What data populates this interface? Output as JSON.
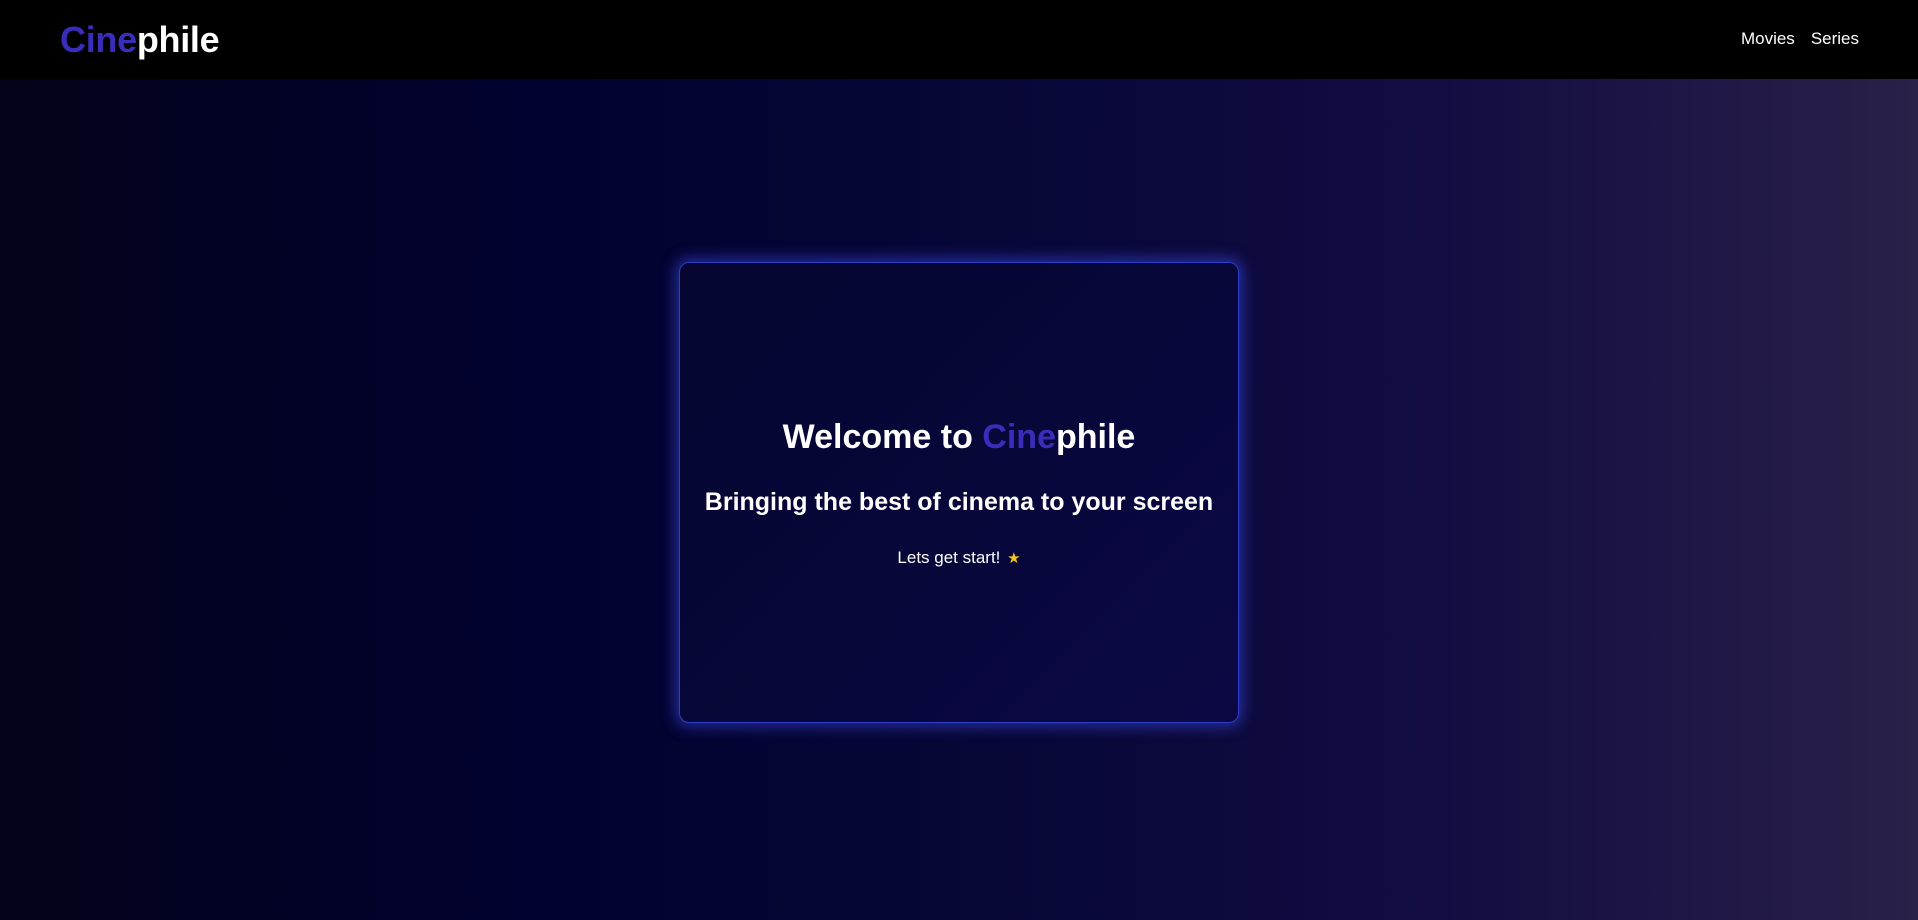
{
  "brand": {
    "prefix": "Cine",
    "suffix": "phile",
    "accent_color": "#3b2dbb"
  },
  "nav": {
    "items": [
      {
        "label": "Movies"
      },
      {
        "label": "Series"
      }
    ]
  },
  "hero": {
    "welcome_prefix": "Welcome to ",
    "brand_prefix": "Cine",
    "brand_suffix": "phile",
    "tagline": "Bringing the best of cinema to your screen",
    "cta_text": "Lets get start!",
    "cta_icon": "star-icon",
    "star_color": "#f5c518",
    "card_border_color": "#2d3ec8"
  }
}
